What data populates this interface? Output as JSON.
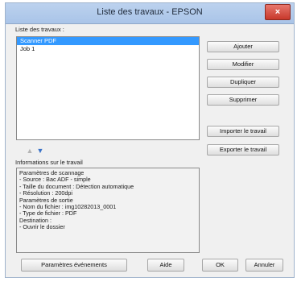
{
  "window": {
    "title": "Liste des travaux - EPSON",
    "close_label": "×"
  },
  "jobs": {
    "label": "Liste des travaux :",
    "items": [
      "Scanner PDF",
      "Job 1"
    ],
    "selected_index": 0
  },
  "buttons": {
    "add": "Ajouter",
    "edit": "Modifier",
    "duplicate": "Dupliquer",
    "delete": "Supprimer",
    "import": "Importer le travail",
    "export": "Exporter le travail",
    "events": "Paramètres événements",
    "help": "Aide",
    "ok": "OK",
    "cancel": "Annuler"
  },
  "icons": {
    "move_up": "▲",
    "move_down": "▼"
  },
  "info": {
    "label": "Informations sur le travail",
    "lines": [
      "Paramètres de scannage",
      "- Source : Bac ADF - simple",
      "- Taille du document : Détection automatique",
      "- Résolution : 200dpi",
      "Paramètres de sortie",
      "- Nom du fichier : img10282013_0001",
      "- Type de fichier : PDF",
      "Destination :",
      "- Ouvrir le dossier"
    ]
  }
}
